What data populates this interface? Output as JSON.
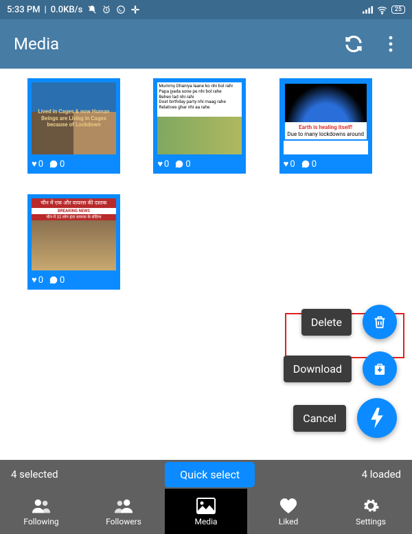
{
  "status": {
    "time": "5:33 PM",
    "net": "0.0KB/s",
    "battery": "25"
  },
  "header": {
    "title": "Media"
  },
  "grid": {
    "items": [
      {
        "caption": "Lived in Cages & now Human Beings are Living in Cages because of Lockdown",
        "likes": "0",
        "comments": "0"
      },
      {
        "caption": "Mummy Dhaniya laane ko nhi bol rahi\nPapa jyada sone pe nhi bol rahe\nBehen lad nhi rahi\nDost birthday party nhi maag rahe\nRelatives ghar nhi aa rahe",
        "likes": "0",
        "comments": "0"
      },
      {
        "caption": "Earth is healing itself!",
        "sub": "Due to many lockdowns around",
        "likes": "0",
        "comments": "0"
      },
      {
        "caption": "चीन में एक और वायरस की दस्तक",
        "sub": "चीन में 32 लोग हंता वायरस के संदिग्ध",
        "likes": "0",
        "comments": "0"
      }
    ]
  },
  "fab": {
    "delete": "Delete",
    "download": "Download",
    "cancel": "Cancel"
  },
  "selbar": {
    "selected": "4 selected",
    "quick": "Quick select",
    "loaded": "4 loaded"
  },
  "nav": {
    "following": "Following",
    "followers": "Followers",
    "media": "Media",
    "liked": "Liked",
    "settings": "Settings"
  }
}
